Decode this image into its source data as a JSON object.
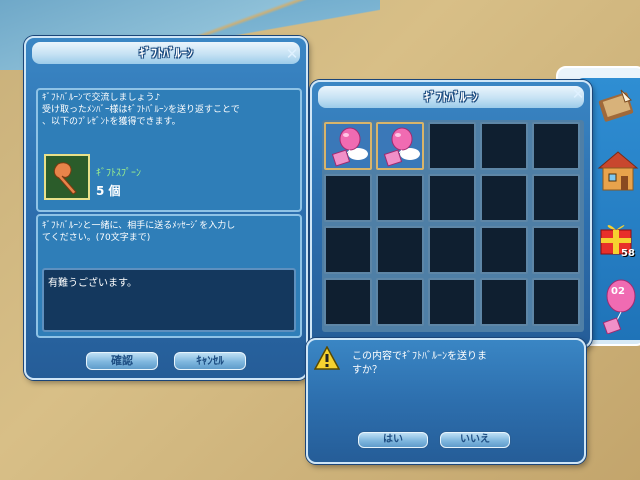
{
  "left_dialog": {
    "title": "ｷﾞﾌﾄﾊﾞﾙｰﾝ",
    "description": "ｷﾞﾌﾄﾊﾞﾙｰﾝで交流しましょう♪\n受け取ったﾒﾝﾊﾞｰ様はｷﾞﾌﾄﾊﾞﾙｰﾝを送り返すことで\n、以下のﾌﾟﾚｾﾞﾝﾄを獲得できます。",
    "reward_name": "ｷﾞﾌﾄｽﾌﾟｰﾝ",
    "reward_count": "5 個",
    "message_instruction": "ｷﾞﾌﾄﾊﾞﾙｰﾝと一緒に、相手に送るﾒｯｾｰｼﾞを入力し\nてください。(70文字まで)",
    "message_value": "有難うございます。",
    "confirm_label": "確認",
    "cancel_label": "ｷｬﾝｾﾙ"
  },
  "inventory": {
    "title": "ｷﾞﾌﾄﾊﾞﾙｰﾝ",
    "rows": 4,
    "cols": 5,
    "filled_slots": 2
  },
  "confirm_dialog": {
    "message": "この内容でｷﾞﾌﾄﾊﾞﾙｰﾝを送りま\nすか？",
    "yes_label": "はい",
    "no_label": "いいえ"
  },
  "side_menu": {
    "gift_count": "58",
    "balloon_count": "02"
  }
}
